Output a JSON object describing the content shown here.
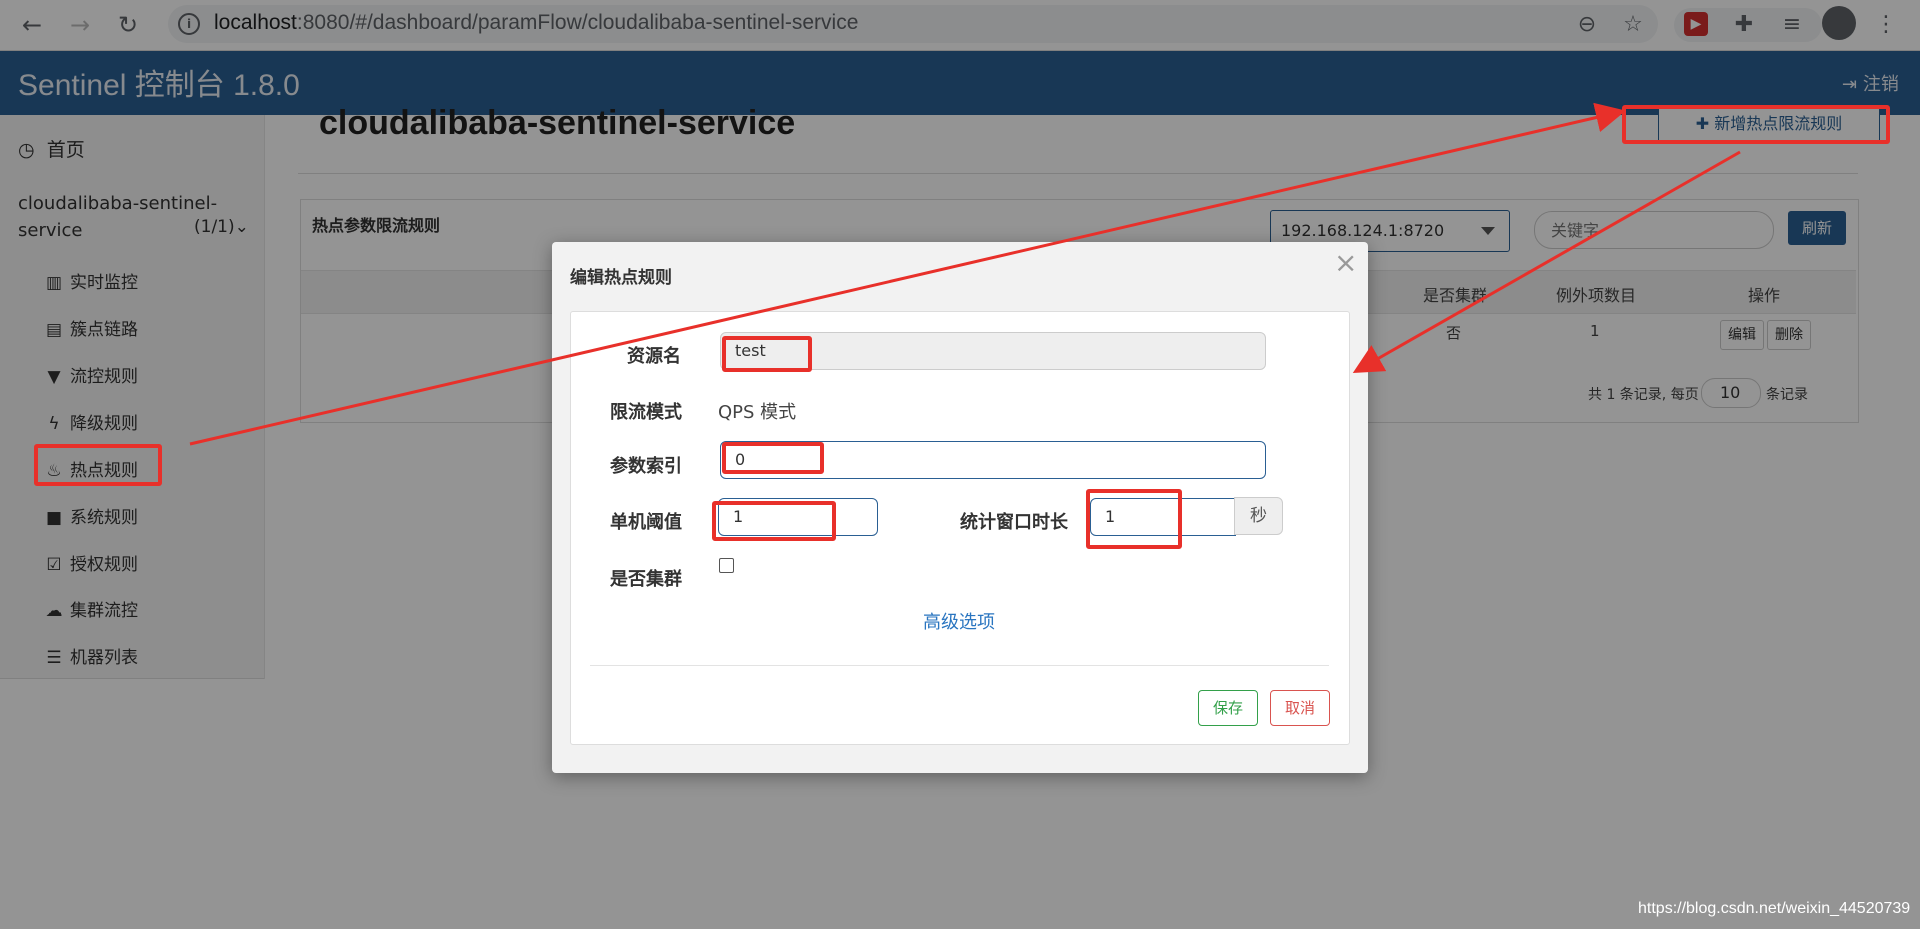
{
  "browser": {
    "url_host": "localhost",
    "url_rest": ":8080/#/dashboard/paramFlow/cloudalibaba-sentinel-service"
  },
  "header": {
    "brand": "Sentinel 控制台 1.8.0",
    "logout": "注销"
  },
  "sidebar": {
    "home": "首页",
    "app_name": "cloudalibaba-sentinel-service",
    "app_count": "(1/1)",
    "items": [
      {
        "icon": "bar-chart-icon",
        "label": "实时监控"
      },
      {
        "icon": "list-icon",
        "label": "簇点链路"
      },
      {
        "icon": "filter-icon",
        "label": "流控规则"
      },
      {
        "icon": "bolt-icon",
        "label": "降级规则"
      },
      {
        "icon": "fire-icon",
        "label": "热点规则"
      },
      {
        "icon": "lock-icon",
        "label": "系统规则"
      },
      {
        "icon": "check-square-icon",
        "label": "授权规则"
      },
      {
        "icon": "cloud-icon",
        "label": "集群流控"
      },
      {
        "icon": "list-bullets-icon",
        "label": "机器列表"
      }
    ]
  },
  "main": {
    "title": "cloudalibaba-sentinel-service",
    "add_button": "新增热点限流规则",
    "panel_title": "热点参数限流规则",
    "machine": "192.168.124.1:8720",
    "keyword_placeholder": "关键字",
    "refresh": "刷新",
    "columns": [
      "是否集群",
      "例外项数目",
      "操作"
    ],
    "row": {
      "cluster": "否",
      "exceptions": "1",
      "edit": "编辑",
      "delete": "删除"
    },
    "pager_prefix": "共 1 条记录, 每页",
    "page_size": "10",
    "pager_suffix": "条记录"
  },
  "modal": {
    "title": "编辑热点规则",
    "close": "×",
    "resource_label": "资源名",
    "resource_value": "test",
    "mode_label": "限流模式",
    "mode_value": "QPS 模式",
    "param_index_label": "参数索引",
    "param_index_value": "0",
    "threshold_label": "单机阈值",
    "threshold_value": "1",
    "window_label": "统计窗口时长",
    "window_value": "1",
    "window_unit": "秒",
    "cluster_label": "是否集群",
    "cluster_checked": false,
    "advanced": "高级选项",
    "save": "保存",
    "cancel": "取消"
  },
  "watermark": "https://blog.csdn.net/weixin_44520739",
  "colors": {
    "brand_blue": "#2a5f93",
    "annotation_red": "#e8302a"
  }
}
